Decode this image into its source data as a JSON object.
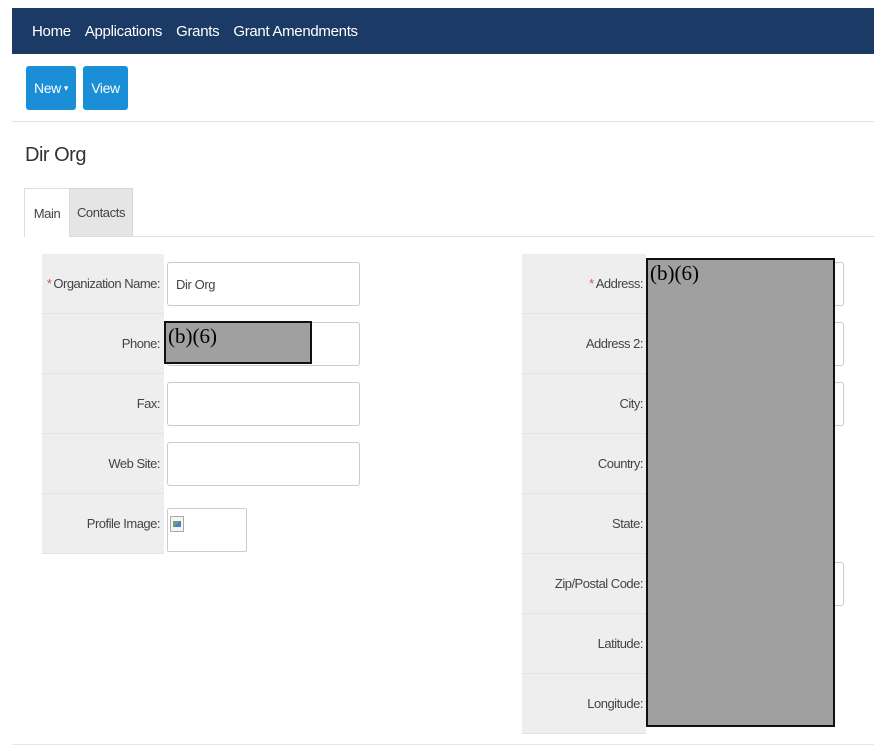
{
  "nav": {
    "items": [
      {
        "label": "Home"
      },
      {
        "label": "Applications"
      },
      {
        "label": "Grants"
      },
      {
        "label": "Grant Amendments"
      }
    ]
  },
  "toolbar": {
    "new_label": "New",
    "view_label": "View"
  },
  "page": {
    "title": "Dir Org"
  },
  "tabs": [
    {
      "label": "Main",
      "active": true
    },
    {
      "label": "Contacts",
      "active": false
    }
  ],
  "form": {
    "left": {
      "org_name_label": "Organization Name:",
      "org_name_value": "Dir Org",
      "phone_label": "Phone:",
      "fax_label": "Fax:",
      "website_label": "Web Site:",
      "profile_image_label": "Profile Image:"
    },
    "right": {
      "address_label": "Address:",
      "address2_label": "Address 2:",
      "city_label": "City:",
      "country_label": "Country:",
      "state_label": "State:",
      "zip_label": "Zip/Postal Code:",
      "latitude_label": "Latitude:",
      "longitude_label": "Longitude:"
    },
    "required_marker": "*",
    "redaction_text": "(b)(6)"
  },
  "colors": {
    "nav_bg": "#1b3a66",
    "button_bg": "#1a8ed6",
    "label_cell_bg": "#eeeeee",
    "redaction_fill": "#a0a0a0",
    "required": "#d9534f"
  }
}
